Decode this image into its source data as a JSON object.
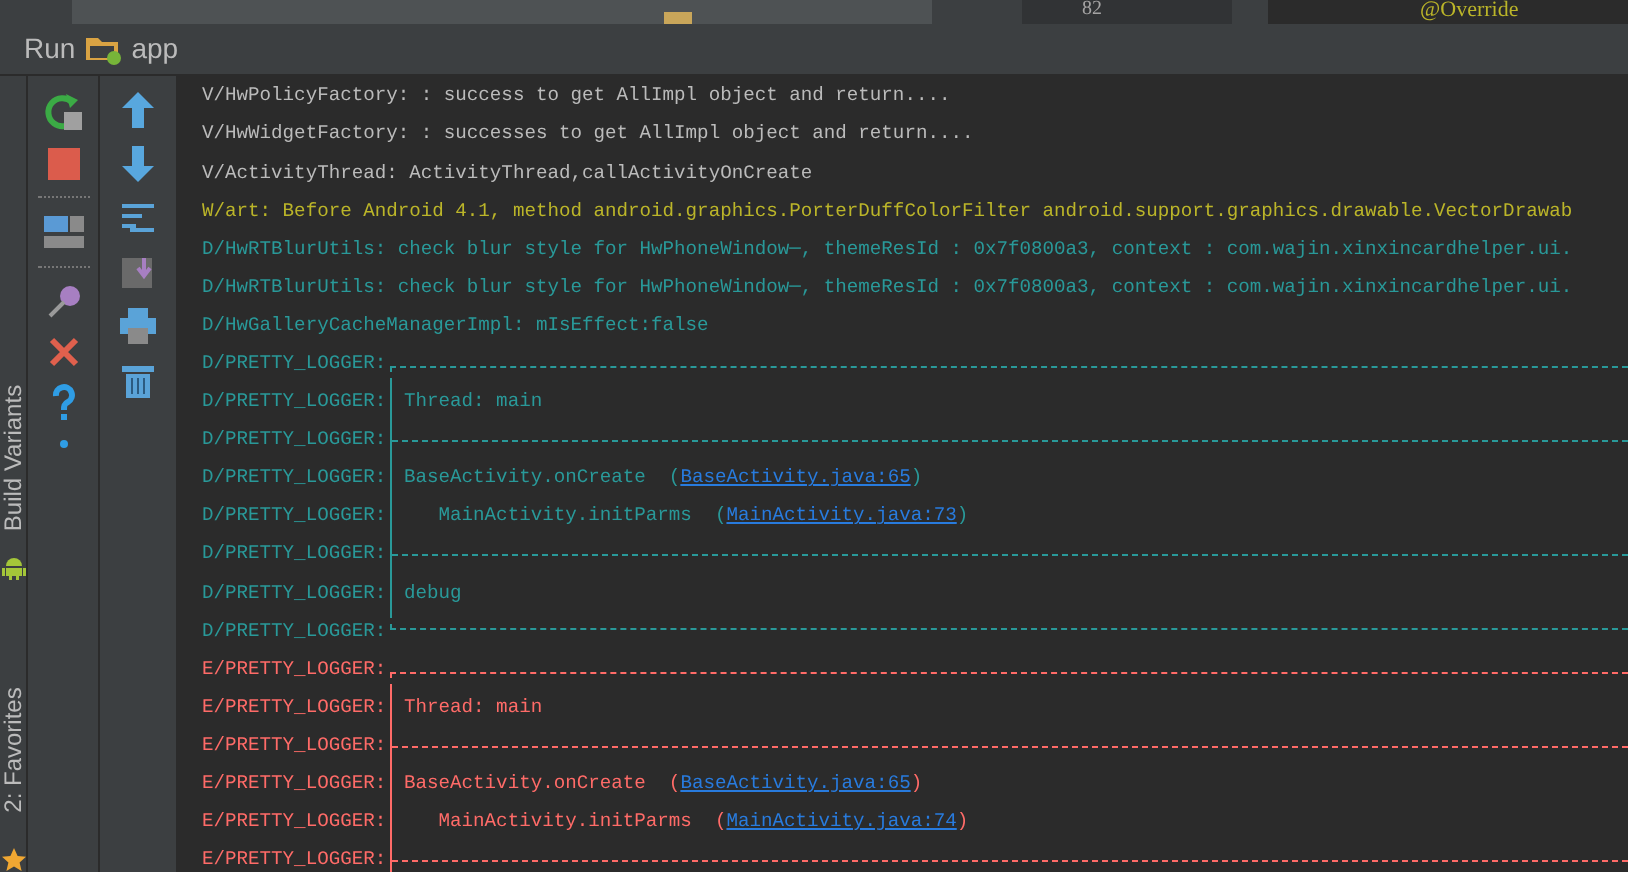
{
  "editor_strip": {
    "line_number": "82",
    "code": "@Override"
  },
  "run_panel": {
    "title": "Run",
    "config": "app"
  },
  "side_tabs": [
    {
      "label": "Build Variants"
    },
    {
      "label": "2: Favorites"
    }
  ],
  "console": [
    {
      "color": "#bbbbbb",
      "kind": "plain",
      "text": "V/HwPolicyFactory: : success to get AllImpl object and return...."
    },
    {
      "color": "#bbbbbb",
      "kind": "plain",
      "text": "V/HwWidgetFactory: : successes to get AllImpl object and return...."
    },
    {
      "color": "#bbbbbb",
      "kind": "plain",
      "text": "V/ActivityThread: ActivityThread,callActivityOnCreate"
    },
    {
      "color": "#bbb529",
      "kind": "plain",
      "text": "W/art: Before Android 4.1, method android.graphics.PorterDuffColorFilter android.support.graphics.drawable.VectorDrawab"
    },
    {
      "color": "#299999",
      "kind": "plain",
      "text": "D/HwRTBlurUtils: check blur style for HwPhoneWindow─, themeResId : 0x7f0800a3, context : com.wajin.xinxincardhelper.ui."
    },
    {
      "color": "#299999",
      "kind": "plain",
      "text": "D/HwRTBlurUtils: check blur style for HwPhoneWindow─, themeResId : 0x7f0800a3, context : com.wajin.xinxincardhelper.ui."
    },
    {
      "color": "#299999",
      "kind": "plain",
      "text": "D/HwGalleryCacheManagerImpl: mIsEffect:false"
    },
    {
      "color": "#299999",
      "kind": "box_top",
      "tag": "D/PRETTY_LOGGER:"
    },
    {
      "color": "#299999",
      "kind": "box_text",
      "tag": "D/PRETTY_LOGGER:",
      "text": "Thread: main"
    },
    {
      "color": "#299999",
      "kind": "box_divider",
      "tag": "D/PRETTY_LOGGER:"
    },
    {
      "color": "#299999",
      "kind": "box_text",
      "tag": "D/PRETTY_LOGGER:",
      "text": "BaseActivity.onCreate  ",
      "open": "(",
      "link": "BaseActivity.java:65",
      "close": ")"
    },
    {
      "color": "#299999",
      "kind": "box_text",
      "tag": "D/PRETTY_LOGGER:",
      "text": "   MainActivity.initParms  ",
      "open": "(",
      "link": "MainActivity.java:73",
      "close": ")"
    },
    {
      "color": "#299999",
      "kind": "box_divider",
      "tag": "D/PRETTY_LOGGER:"
    },
    {
      "color": "#299999",
      "kind": "box_text",
      "tag": "D/PRETTY_LOGGER:",
      "text": "debug"
    },
    {
      "color": "#299999",
      "kind": "box_bottom",
      "tag": "D/PRETTY_LOGGER:"
    },
    {
      "color": "#ff6b68",
      "kind": "box_top",
      "tag": "E/PRETTY_LOGGER:"
    },
    {
      "color": "#ff6b68",
      "kind": "box_text",
      "tag": "E/PRETTY_LOGGER:",
      "text": "Thread: main"
    },
    {
      "color": "#ff6b68",
      "kind": "box_divider",
      "tag": "E/PRETTY_LOGGER:"
    },
    {
      "color": "#ff6b68",
      "kind": "box_text",
      "tag": "E/PRETTY_LOGGER:",
      "text": "BaseActivity.onCreate  ",
      "open": "(",
      "link": "BaseActivity.java:65",
      "close": ")"
    },
    {
      "color": "#ff6b68",
      "kind": "box_text",
      "tag": "E/PRETTY_LOGGER:",
      "text": "   MainActivity.initParms  ",
      "open": "(",
      "link": "MainActivity.java:74",
      "close": ")"
    },
    {
      "color": "#ff6b68",
      "kind": "box_divider",
      "tag": "E/PRETTY_LOGGER:"
    }
  ]
}
